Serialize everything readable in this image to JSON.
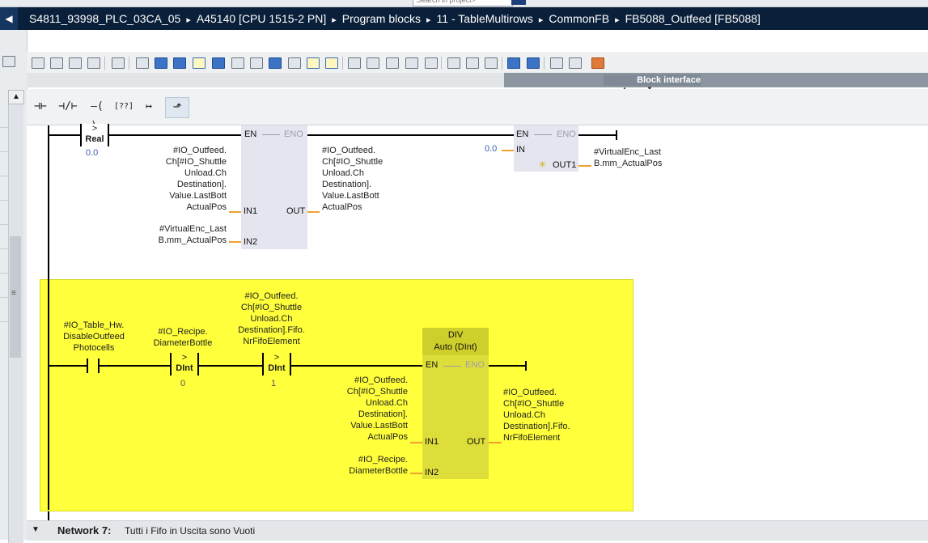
{
  "breadcrumb": {
    "collapse_glyph": "◀",
    "items": [
      "S4811_93998_PLC_03CA_05",
      "A45140 [CPU 1515-2 PN]",
      "Program blocks",
      "11 - TableMultirows",
      "CommonFB",
      "FB5088_Outfeed [FB5088]"
    ],
    "separator": "▸"
  },
  "top_search": {
    "placeholder": "Search in project>"
  },
  "block_interface": {
    "label": "Block interface"
  },
  "ladder_toolbar": {
    "no_contact": "⊣⊢",
    "nc_contact": "⊣/⊢",
    "coil": "–( )–",
    "empty_box": "[??]",
    "open_branch": "↦",
    "close_branch": "⬏"
  },
  "network6_top": {
    "cmp": {
      "symbol": ">",
      "type": "Real",
      "value": "0.0"
    },
    "box1": {
      "en": "EN",
      "eno": "ENO",
      "in1_label": "IN1",
      "in2_label": "IN2",
      "out_label": "OUT",
      "in1_operand": "#IO_Outfeed.\nCh[#IO_Shuttle\nUnload.Ch\nDestination].\nValue.LastBott\nActualPos",
      "in2_operand": "#VirtualEnc_Last\nB.mm_ActualPos",
      "out_operand": "#IO_Outfeed.\nCh[#IO_Shuttle\nUnload.Ch\nDestination].\nValue.LastBott\nActualPos"
    },
    "box2": {
      "en": "EN",
      "eno": "ENO",
      "in_label": "IN",
      "out_label": "OUT1",
      "in_value": "0.0",
      "out_operand": "#VirtualEnc_Last\nB.mm_ActualPos"
    }
  },
  "network6_bottom": {
    "contact": {
      "operand": "#IO_Table_Hw.\nDisableOutfeed\nPhotocells"
    },
    "cmp1": {
      "operand": "#IO_Recipe.\nDiameterBottle",
      "symbol": ">",
      "type": "DInt",
      "value": "0"
    },
    "cmp2": {
      "operand": "#IO_Outfeed.\nCh[#IO_Shuttle\nUnload.Ch\nDestination].Fifo.\nNrFifoElement",
      "symbol": ">",
      "type": "DInt",
      "value": "1"
    },
    "div": {
      "title": "DIV",
      "subtitle": "Auto (DInt)",
      "en": "EN",
      "eno": "ENO",
      "in1_label": "IN1",
      "in2_label": "IN2",
      "out_label": "OUT",
      "in1_operand": "#IO_Outfeed.\nCh[#IO_Shuttle\nUnload.Ch\nDestination].\nValue.LastBott\nActualPos",
      "in2_operand": "#IO_Recipe.\nDiameterBottle",
      "out_operand": "#IO_Outfeed.\nCh[#IO_Shuttle\nUnload.Ch\nDestination].Fifo.\nNrFifoElement"
    }
  },
  "network7": {
    "collapse_glyph": "▼",
    "number": "Network 7:",
    "title": "Tutti i Fifo in Uscita sono Vuoti"
  },
  "colors": {
    "highlight": "#ffff3c",
    "breadcrumb_bg": "#0a1f3a",
    "operand_wire": "#f0a030",
    "value_blue": "#3a5fb0"
  }
}
